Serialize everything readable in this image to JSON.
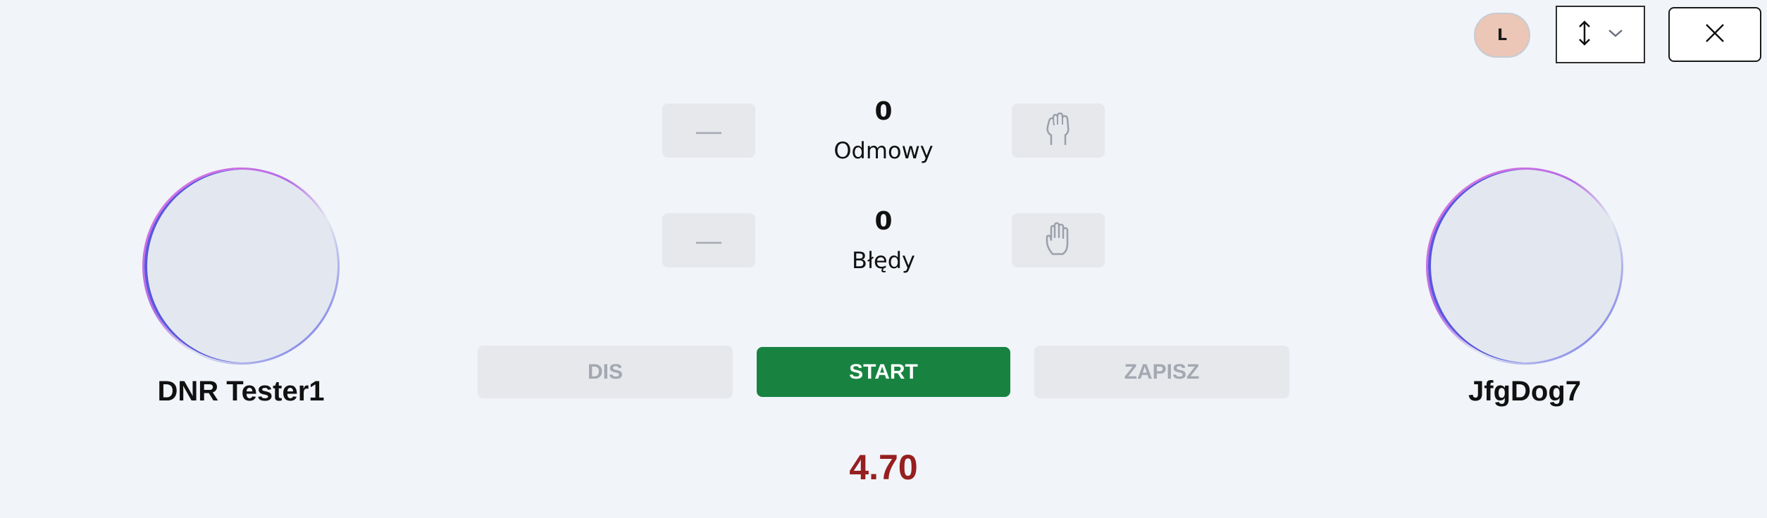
{
  "header": {
    "user_initial": "L",
    "sort_icon": "vertical-arrows-icon",
    "dropdown_icon": "chevron-down-icon",
    "close_icon": "close-icon"
  },
  "players": {
    "left": {
      "name": "DNR Tester1"
    },
    "right": {
      "name": "JfgDog7"
    }
  },
  "counters": [
    {
      "value": "0",
      "label": "Odmowy",
      "decrement_icon": "minus-icon",
      "increment_icon": "fist-icon"
    },
    {
      "value": "0",
      "label": "Błędy",
      "decrement_icon": "minus-icon",
      "increment_icon": "open-hand-icon"
    }
  ],
  "actions": {
    "dis_label": "DIS",
    "start_label": "START",
    "save_label": "ZAPISZ"
  },
  "timer": "4.70",
  "colors": {
    "background": "#f1f4f9",
    "start_green": "#188341",
    "timer_red": "#961f1f",
    "disabled_bg": "#e6e8ec",
    "disabled_text": "#a3a8b1",
    "badge_bg": "#ecc6b7"
  }
}
